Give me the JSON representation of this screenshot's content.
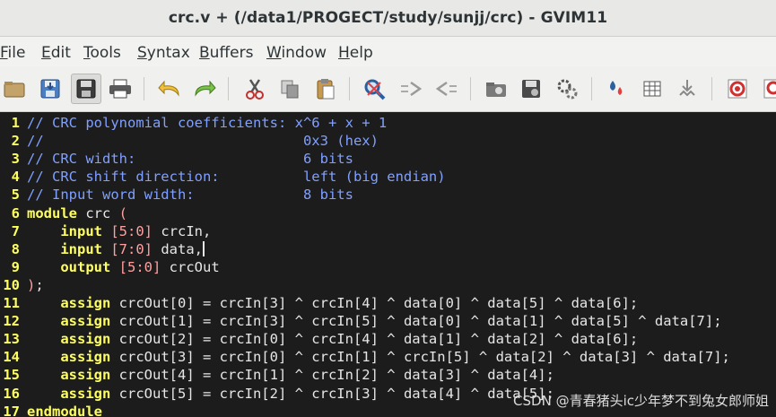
{
  "window": {
    "title": "crc.v + (/data1/PROGECT/study/sunjj/crc) - GVIM11"
  },
  "menu": {
    "items": [
      {
        "first": "F",
        "rest": "ile"
      },
      {
        "first": "E",
        "rest": "dit"
      },
      {
        "first": "T",
        "rest": "ools"
      },
      {
        "first": "S",
        "rest": "yntax"
      },
      {
        "first": "B",
        "rest": "uffers"
      },
      {
        "first": "W",
        "rest": "indow"
      },
      {
        "first": "H",
        "rest": "elp"
      }
    ]
  },
  "toolbar": {
    "icons": [
      "open-icon",
      "save-icon",
      "save-all-icon",
      "print-icon",
      "undo-icon",
      "redo-icon",
      "cut-icon",
      "copy-icon",
      "paste-icon",
      "find-replace-icon",
      "find-next-icon",
      "find-prev-icon",
      "load-session-icon",
      "save-session-icon",
      "run-script-icon",
      "make-icon",
      "shell-icon",
      "ctags-icon",
      "help-icon",
      "find-help-icon"
    ]
  },
  "editor": {
    "line_numbers": [
      "1",
      "2",
      "3",
      "4",
      "5",
      "6",
      "7",
      "8",
      "9",
      "10",
      "11",
      "12",
      "13",
      "14",
      "15",
      "16",
      "17"
    ],
    "lines": [
      [
        {
          "c": "cm",
          "t": "// CRC polynomial coefficients: x^6 + x + 1"
        }
      ],
      [
        {
          "c": "cm",
          "t": "//                               0x3 (hex)"
        }
      ],
      [
        {
          "c": "cm",
          "t": "// CRC width:                    6 bits"
        }
      ],
      [
        {
          "c": "cm",
          "t": "// CRC shift direction:          left (big endian)"
        }
      ],
      [
        {
          "c": "cm",
          "t": "// Input word width:             8 bits"
        }
      ],
      [
        {
          "c": "kw",
          "t": "module"
        },
        {
          "c": "id",
          "t": " crc "
        },
        {
          "c": "br",
          "t": "("
        }
      ],
      [
        {
          "c": "id",
          "t": "    "
        },
        {
          "c": "kw",
          "t": "input"
        },
        {
          "c": "id",
          "t": " "
        },
        {
          "c": "br",
          "t": "[5:0]"
        },
        {
          "c": "id",
          "t": " crcIn,"
        }
      ],
      [
        {
          "c": "id",
          "t": "    "
        },
        {
          "c": "kw",
          "t": "input"
        },
        {
          "c": "id",
          "t": " "
        },
        {
          "c": "br",
          "t": "[7:0]"
        },
        {
          "c": "id",
          "t": " data,"
        },
        {
          "c": "cursor",
          "t": ""
        }
      ],
      [
        {
          "c": "id",
          "t": "    "
        },
        {
          "c": "kw",
          "t": "output"
        },
        {
          "c": "id",
          "t": " "
        },
        {
          "c": "br",
          "t": "[5:0]"
        },
        {
          "c": "id",
          "t": " crcOut"
        }
      ],
      [
        {
          "c": "br",
          "t": ")"
        },
        {
          "c": "id",
          "t": ";"
        }
      ],
      [
        {
          "c": "id",
          "t": "    "
        },
        {
          "c": "kw",
          "t": "assign"
        },
        {
          "c": "id",
          "t": " crcOut[0] = crcIn[3] ^ crcIn[4] ^ data[0] ^ data[5] ^ data[6];"
        }
      ],
      [
        {
          "c": "id",
          "t": "    "
        },
        {
          "c": "kw",
          "t": "assign"
        },
        {
          "c": "id",
          "t": " crcOut[1] = crcIn[3] ^ crcIn[5] ^ data[0] ^ data[1] ^ data[5] ^ data[7];"
        }
      ],
      [
        {
          "c": "id",
          "t": "    "
        },
        {
          "c": "kw",
          "t": "assign"
        },
        {
          "c": "id",
          "t": " crcOut[2] = crcIn[0] ^ crcIn[4] ^ data[1] ^ data[2] ^ data[6];"
        }
      ],
      [
        {
          "c": "id",
          "t": "    "
        },
        {
          "c": "kw",
          "t": "assign"
        },
        {
          "c": "id",
          "t": " crcOut[3] = crcIn[0] ^ crcIn[1] ^ crcIn[5] ^ data[2] ^ data[3] ^ data[7];"
        }
      ],
      [
        {
          "c": "id",
          "t": "    "
        },
        {
          "c": "kw",
          "t": "assign"
        },
        {
          "c": "id",
          "t": " crcOut[4] = crcIn[1] ^ crcIn[2] ^ data[3] ^ data[4];"
        }
      ],
      [
        {
          "c": "id",
          "t": "    "
        },
        {
          "c": "kw",
          "t": "assign"
        },
        {
          "c": "id",
          "t": " crcOut[5] = crcIn[2] ^ crcIn[3] ^ data[4] ^ data[5];"
        }
      ],
      [
        {
          "c": "kw",
          "t": "endmodule"
        }
      ]
    ]
  },
  "watermark": "CSDN @青春猪头ic少年梦不到兔女郎师姐",
  "colors": {
    "background": "#1c1c1c",
    "comment": "#80a0ff",
    "keyword": "#ffff60",
    "bracket": "#ffa0a0",
    "line_number": "#ffff60"
  }
}
